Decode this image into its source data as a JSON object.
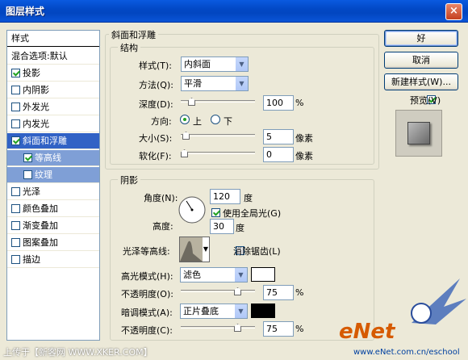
{
  "window": {
    "title": "图层样式",
    "close_glyph": "×"
  },
  "style_list": {
    "header": "样式",
    "blend_options": "混合选项:默认",
    "items": [
      {
        "label": "投影",
        "checked": true
      },
      {
        "label": "内阴影",
        "checked": false
      },
      {
        "label": "外发光",
        "checked": false
      },
      {
        "label": "内发光",
        "checked": false
      },
      {
        "label": "斜面和浮雕",
        "checked": true
      },
      {
        "label": "等高线",
        "checked": true
      },
      {
        "label": "纹理",
        "checked": false
      },
      {
        "label": "光泽",
        "checked": false
      },
      {
        "label": "颜色叠加",
        "checked": false
      },
      {
        "label": "渐变叠加",
        "checked": false
      },
      {
        "label": "图案叠加",
        "checked": false
      },
      {
        "label": "描边",
        "checked": false
      }
    ]
  },
  "bevel": {
    "title": "斜面和浮雕",
    "structure": {
      "title": "结构",
      "style_label": "样式(T):",
      "style_value": "内斜面",
      "technique_label": "方法(Q):",
      "technique_value": "平滑",
      "depth_label": "深度(D):",
      "depth_value": "100",
      "depth_unit": "%",
      "depth_slider_fraction": 0.1,
      "direction_label": "方向:",
      "direction_up": "上",
      "direction_down": "下",
      "direction_selected": "上",
      "size_label": "大小(S):",
      "size_value": "5",
      "size_unit": "像素",
      "size_slider_fraction": 0.02,
      "soften_label": "软化(F):",
      "soften_value": "0",
      "soften_unit": "像素",
      "soften_slider_fraction": 0.0
    },
    "shading": {
      "title": "阴影",
      "angle_label": "角度(N):",
      "angle_value": "120",
      "angle_unit": "度",
      "global_light_label": "使用全局光(G)",
      "global_light_checked": true,
      "altitude_label": "高度:",
      "altitude_value": "30",
      "altitude_unit": "度",
      "gloss_contour_label": "光泽等高线:",
      "anti_alias_label": "消除锯齿(L)",
      "anti_alias_checked": false,
      "highlight_mode_label": "高光模式(H):",
      "highlight_mode_value": "滤色",
      "highlight_color": "#ffffff",
      "highlight_opacity_label": "不透明度(O):",
      "highlight_opacity_value": "75",
      "highlight_opacity_unit": "%",
      "highlight_opacity_fraction": 0.75,
      "shadow_mode_label": "暗调模式(A):",
      "shadow_mode_value": "正片叠底",
      "shadow_color": "#000000",
      "shadow_opacity_label": "不透明度(C):",
      "shadow_opacity_value": "75",
      "shadow_opacity_unit": "%",
      "shadow_opacity_fraction": 0.75
    }
  },
  "buttons": {
    "ok": "好",
    "cancel": "取消",
    "new_style": "新建样式(W)...",
    "preview_label": "预览(V)",
    "preview_checked": true
  },
  "watermarks": {
    "footer_left": "上传于【新客网 WWW.XKER.COM】",
    "enet": "eNet",
    "enet_url": "www.eNet.com.cn/eschool"
  }
}
